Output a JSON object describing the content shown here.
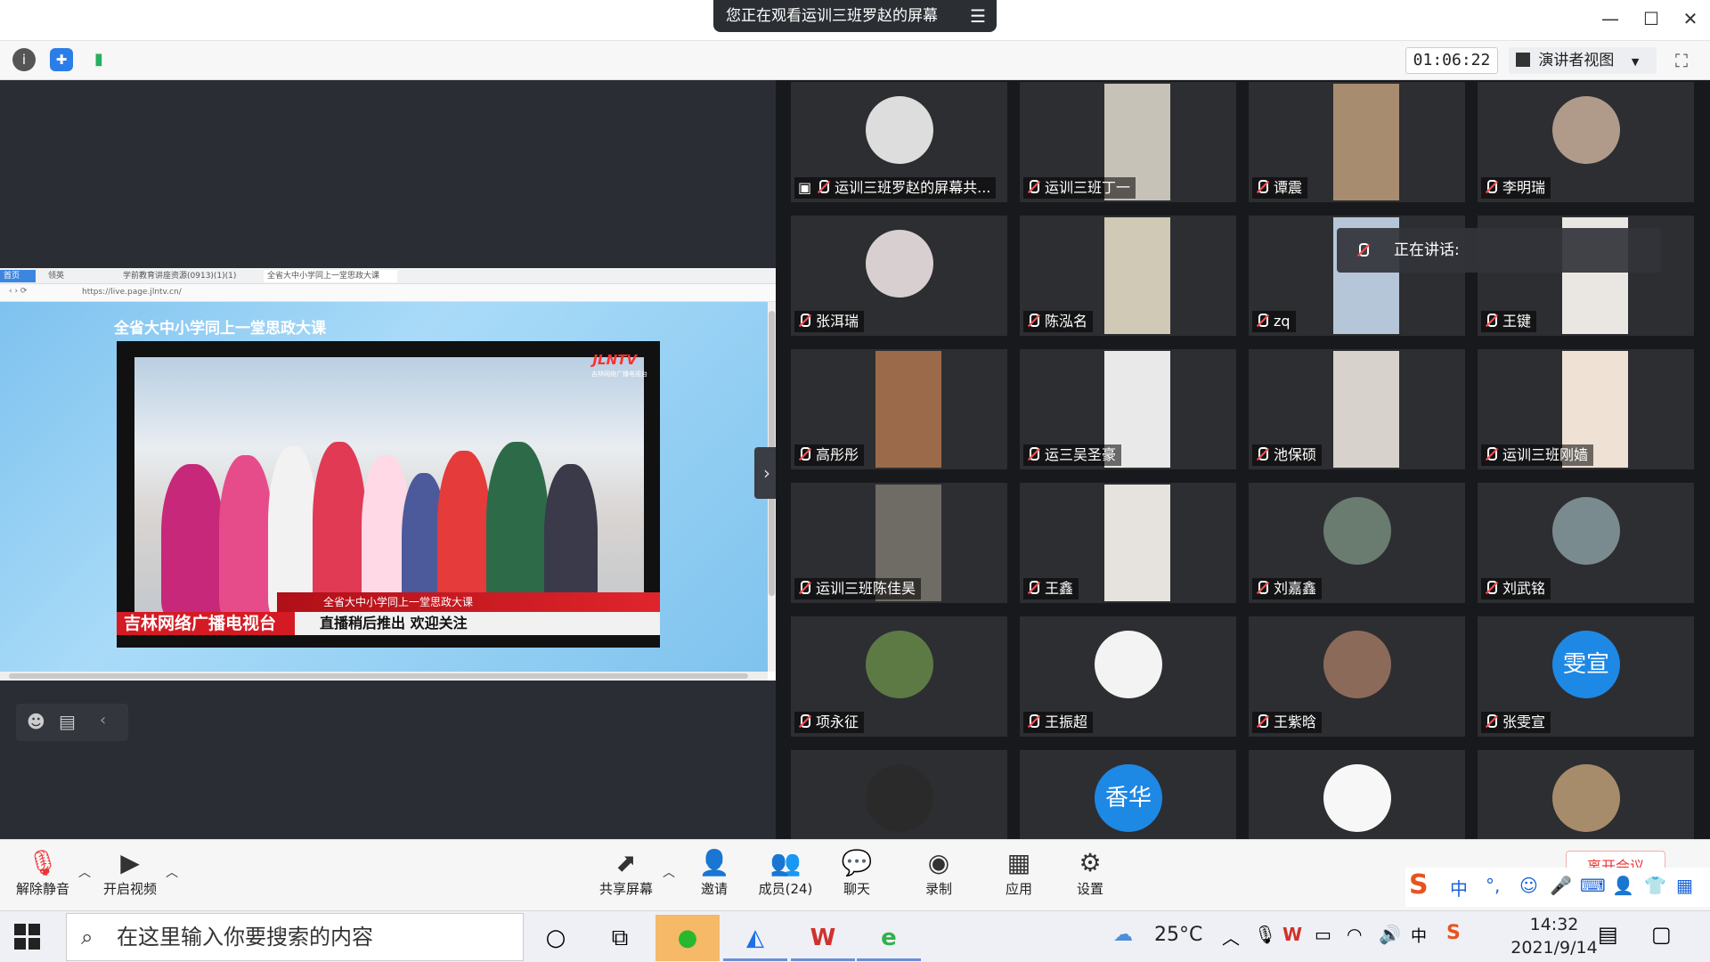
{
  "window": {
    "share_banner": "您正在观看运训三班罗赵的屏幕",
    "menu_glyph": "☰",
    "minimize": "—",
    "maximize": "☐",
    "close": "✕"
  },
  "topbar": {
    "timer": "01:06:22",
    "view_mode": "演讲者视图",
    "icons": [
      "info-icon",
      "shield-icon",
      "signal-icon"
    ]
  },
  "shared_screen": {
    "browser_tabs": [
      "首页",
      "领英",
      "学前教育讲座资源(0913)(1)(1)",
      "全省大中小学同上一堂思政大课"
    ],
    "url": "https://live.page.jlntv.cn/",
    "page_heading": "全省大中小学同上一堂思政大课",
    "video_logo": "JLNTV",
    "video_logo_sub": "吉林网络广播电视台",
    "lower_third_top": "全省大中小学同上一堂思政大课",
    "lower_third_brand": "吉林网络广播电视台",
    "lower_third_text": "直播稍后推出  欢迎关注"
  },
  "speaking": "正在讲话:",
  "participants": [
    {
      "name": "运训三班罗赵的屏幕共...",
      "share": true
    },
    {
      "name": "运训三班丁一"
    },
    {
      "name": "谭震"
    },
    {
      "name": "李明瑞"
    },
    {
      "name": "张洱瑞"
    },
    {
      "name": "陈泓名"
    },
    {
      "name": "zq"
    },
    {
      "name": "王键"
    },
    {
      "name": "高彤彤"
    },
    {
      "name": "运三吴圣豪"
    },
    {
      "name": "池保硕"
    },
    {
      "name": "运训三班刚嫱"
    },
    {
      "name": "运训三班陈佳昊"
    },
    {
      "name": "王鑫"
    },
    {
      "name": "刘嘉鑫"
    },
    {
      "name": "刘武铭"
    },
    {
      "name": "项永征"
    },
    {
      "name": "王振超"
    },
    {
      "name": "王紫晗"
    },
    {
      "name": "张雯宣",
      "avatar_text": "雯宣"
    },
    {
      "name": ""
    },
    {
      "name": "",
      "avatar_text": "香华"
    },
    {
      "name": ""
    },
    {
      "name": ""
    }
  ],
  "meeting_toolbar": {
    "unmute": "解除静音",
    "start_video": "开启视频",
    "share_screen": "共享屏幕",
    "invite": "邀请",
    "members": "成员(24)",
    "chat": "聊天",
    "record": "录制",
    "apps": "应用",
    "settings": "设置",
    "leave": "离开会议"
  },
  "ime": {
    "lang": "中",
    "punct": "°,"
  },
  "taskbar": {
    "search_placeholder": "在这里输入你要搜索的内容",
    "weather": "25°C",
    "ime_indicator": "中",
    "time": "14:32",
    "date": "2021/9/14"
  }
}
